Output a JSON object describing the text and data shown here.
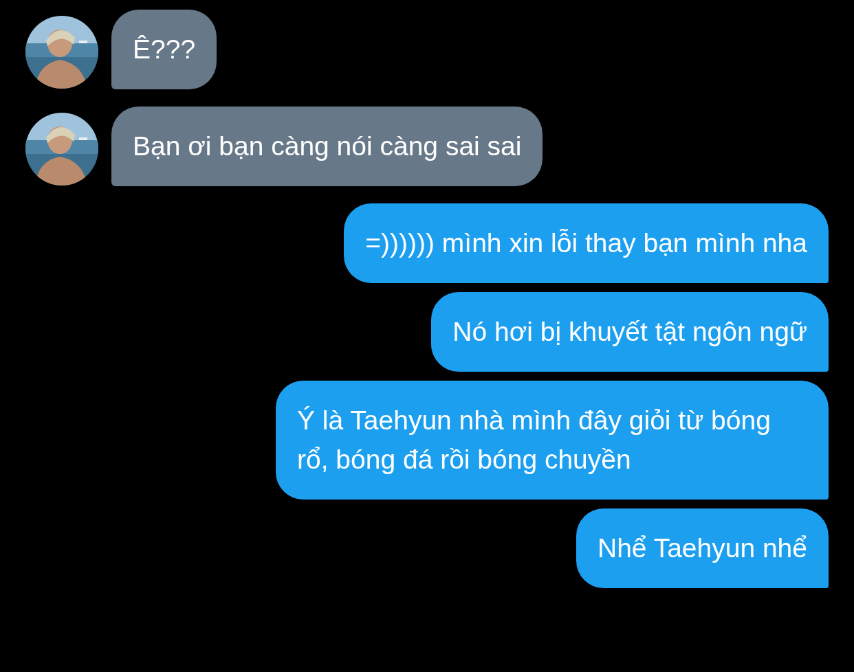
{
  "messages": [
    {
      "kind": "incoming",
      "text": "Ê???"
    },
    {
      "kind": "incoming",
      "text": "Bạn ơi bạn càng nói càng sai sai"
    },
    {
      "kind": "outgoing",
      "text": "=)))))) mình xin lỗi thay bạn mình nha"
    },
    {
      "kind": "outgoing",
      "text": "Nó hơi bị khuyết tật ngôn ngữ"
    },
    {
      "kind": "outgoing",
      "text": "Ý là Taehyun nhà mình đây giỏi từ bóng rổ, bóng đá rồi bóng chuyền"
    },
    {
      "kind": "outgoing",
      "text": "Nhể Taehyun nhể"
    }
  ]
}
